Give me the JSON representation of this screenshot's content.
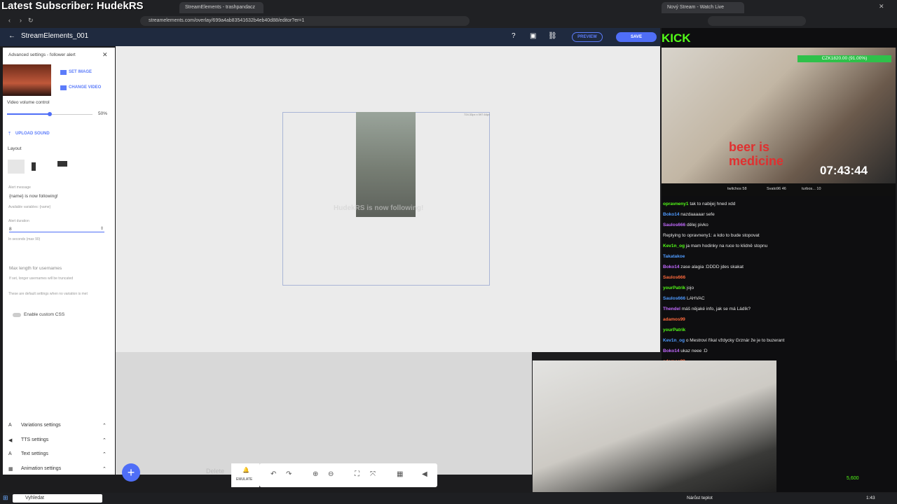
{
  "overlay_title": "Latest Subscriber: HudekRS",
  "browser": {
    "tabs": [
      "StreamElements - trashpandacz",
      "Nový Stream - Watch Live"
    ],
    "url": "streamelements.com/overlay/699a4ab83541632b4eb40d88/editor?er=1"
  },
  "header": {
    "title": "StreamElements_001",
    "preview": "PREVIEW",
    "save": "SAVE"
  },
  "sidebar": {
    "panel_title": "Advanced settings - follower alert",
    "set_image": "SET IMAGE",
    "change_video": "CHANGE VIDEO",
    "volume_label": "Video volume control",
    "volume_value": "50%",
    "volume_fraction": 0.5,
    "upload_sound": "UPLOAD SOUND",
    "layout_label": "Layout",
    "alert_message_label": "Alert message",
    "alert_message_value": "{name} is now following!",
    "available_vars": "Available variables: {name}",
    "alert_duration_label": "Alert duration",
    "alert_duration_value": "8",
    "duration_hint": "In seconds (max 90)",
    "max_len_label": "Max length for usernames",
    "max_len_hint": "If set, longer usernames will be truncated",
    "default_note": "These are default settings when no variation is met",
    "custom_css": "Enable custom CSS",
    "sections": [
      "Variations settings",
      "TTS settings",
      "Text settings",
      "Animation settings"
    ]
  },
  "canvas": {
    "frame_label": "724.33px x 597.64px",
    "ghost_text": "HudekRS is now following!",
    "delete_ghost": "Delete"
  },
  "toolbar": {
    "emulate": "EMULATE"
  },
  "stream": {
    "platform": "KICK",
    "donation_bar": "CZK1820.00 (91.00%)",
    "timer": "07:43:44",
    "shirt_text": "beer is medicine",
    "supporters": [
      "twitchos 58",
      "Svato96 46",
      "turbos... 10"
    ],
    "chat": [
      {
        "user": "opravneny1",
        "msg": "tak to nabijej hned xdd"
      },
      {
        "user": "Boko14",
        "msg": "nazdaaaaar sefe"
      },
      {
        "user": "Saulos666",
        "msg": "dělej pivko"
      },
      {
        "user": "",
        "msg": "Replying to opravneny1: a kdo to bude stopovat"
      },
      {
        "user": "Kev1n_og",
        "msg": "ja mam hodinky na ruce to klidně stopnu"
      },
      {
        "user": "Takatakoe",
        "msg": ""
      },
      {
        "user": "Boko14",
        "msg": "zase alagia :DDDD jdes skakat"
      },
      {
        "user": "Saulos666",
        "msg": ""
      },
      {
        "user": "yourPatrik",
        "msg": "jojo"
      },
      {
        "user": "Saulos666",
        "msg": "LAHVAC"
      },
      {
        "user": "Thendel",
        "msg": "máš nějaké info, jak se má Ládík?"
      },
      {
        "user": "adamos99",
        "msg": ""
      },
      {
        "user": "yourPatrik",
        "msg": ""
      },
      {
        "user": "Kev1n_og",
        "msg": "o Mestrovi říkal vždycky Grznár že je to buzerant"
      },
      {
        "user": "Boko14",
        "msg": "ukaz neee :D"
      },
      {
        "user": "adamos99",
        "msg": ""
      }
    ],
    "points": "5,600"
  },
  "taskbar": {
    "search": "Vyhledat",
    "weather": "Nárůst teplot",
    "time": "1:43"
  },
  "colors": {
    "accent": "#4f6ef7",
    "kick_green": "#53fc18",
    "header_bg": "#1f2a3f"
  }
}
